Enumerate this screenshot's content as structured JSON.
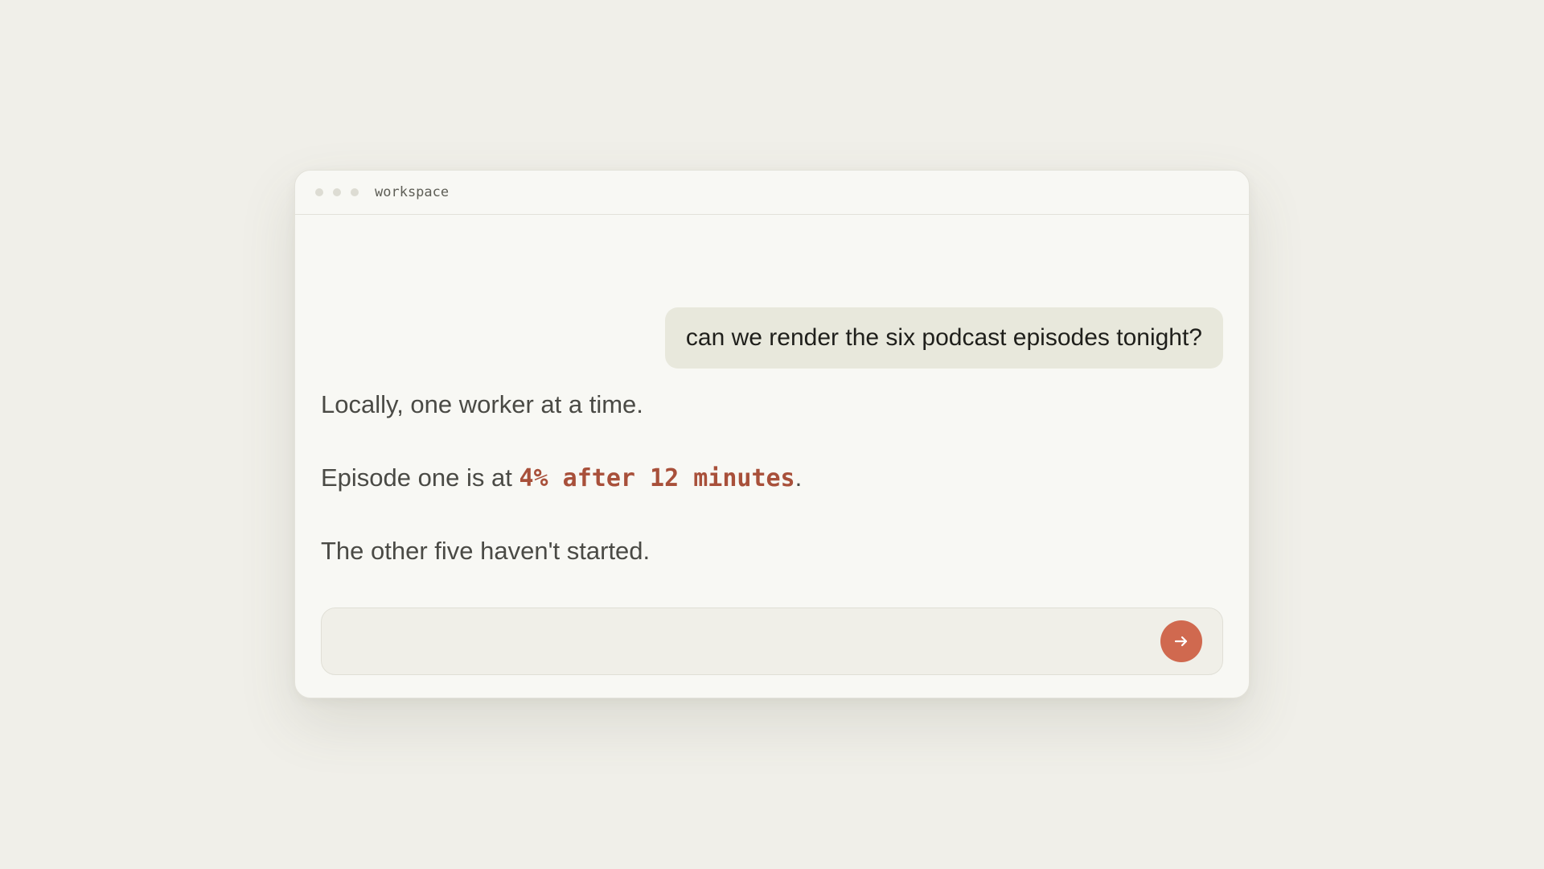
{
  "window": {
    "title": "workspace"
  },
  "conversation": {
    "user_message": "can we render the six podcast episodes tonight?",
    "reply_line_1": "Locally, one worker at a time.",
    "reply_line_2_prefix": "Episode one is at ",
    "reply_line_2_highlight": "4% after 12 minutes",
    "reply_line_2_suffix": ".",
    "reply_line_3": "The other five haven't started."
  },
  "composer": {
    "placeholder": "",
    "send_icon": "arrow-right-icon"
  },
  "colors": {
    "background": "#f0efe9",
    "window": "#f8f8f4",
    "user_bubble": "#e8e8dc",
    "accent": "#d0694f",
    "highlight_text": "#a8503a"
  }
}
